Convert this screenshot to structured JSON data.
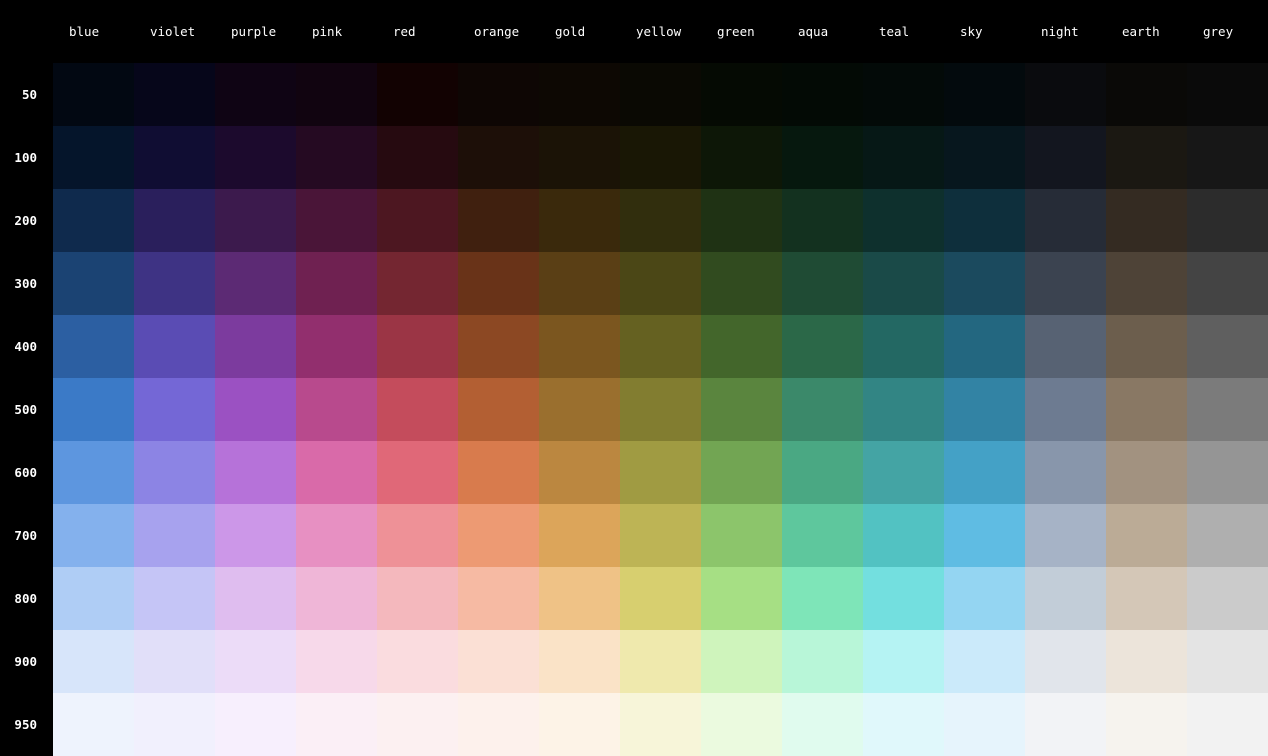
{
  "columns": [
    "blue",
    "violet",
    "purple",
    "pink",
    "red",
    "orange",
    "gold",
    "yellow",
    "green",
    "aqua",
    "teal",
    "sky",
    "night",
    "earth",
    "grey"
  ],
  "rows": [
    "50",
    "100",
    "200",
    "300",
    "400",
    "500",
    "600",
    "700",
    "800",
    "900",
    "950"
  ],
  "colors": {
    "background": "#000000",
    "text": "#ffffff",
    "swatches": [
      [
        "#020812",
        "#06061a",
        "#0f0414",
        "#110410",
        "#120202",
        "#0e0604",
        "#0d0803",
        "#0a0903",
        "#050a03",
        "#030a05",
        "#030a08",
        "#030a0d",
        "#0a0b0e",
        "#0a0907",
        "#0a0a0a"
      ],
      [
        "#05152b",
        "#100d33",
        "#1c0a2d",
        "#250a22",
        "#260a10",
        "#1d0f08",
        "#1b1306",
        "#191705",
        "#0d1707",
        "#06180e",
        "#061816",
        "#07171e",
        "#13161f",
        "#1b1812",
        "#171717"
      ],
      [
        "#0f2a4d",
        "#2a1f5c",
        "#3c1a4d",
        "#4a1538",
        "#4d1721",
        "#40200f",
        "#3a290c",
        "#312e0d",
        "#1f3214",
        "#13311f",
        "#0e302d",
        "#0e2f3c",
        "#262c37",
        "#342b22",
        "#2c2c2c"
      ],
      [
        "#1b4373",
        "#3e3384",
        "#5c2a74",
        "#6f2151",
        "#742631",
        "#693318",
        "#5a3f15",
        "#4b4716",
        "#314b1f",
        "#1f4b34",
        "#1a4a48",
        "#1b4a5e",
        "#3b4350",
        "#4e4337",
        "#444444"
      ],
      [
        "#2c5fa2",
        "#5a4cb4",
        "#7c3b9e",
        "#922f6e",
        "#9b3545",
        "#8c4823",
        "#7b561f",
        "#656121",
        "#43662b",
        "#2b6848",
        "#236863",
        "#236780",
        "#576273",
        "#6c5e4d",
        "#5f5f5f"
      ],
      [
        "#3b7ac7",
        "#7467d6",
        "#9b51c2",
        "#b84a8d",
        "#c44c5c",
        "#b35f33",
        "#9a6f2e",
        "#827d30",
        "#5a853e",
        "#3b896a",
        "#328584",
        "#3283a4",
        "#6d7b91",
        "#897864",
        "#7b7b7b"
      ],
      [
        "#5d96df",
        "#8c84e4",
        "#b672d9",
        "#d96aa9",
        "#e06878",
        "#d87b4d",
        "#bb8740",
        "#a09b42",
        "#72a553",
        "#4aa883",
        "#44a4a4",
        "#44a1c6",
        "#8896ab",
        "#a29280",
        "#959595"
      ],
      [
        "#84b1ed",
        "#a7a2ee",
        "#cc97e8",
        "#e790c2",
        "#ee9197",
        "#ed9a73",
        "#dca55a",
        "#bdb455",
        "#8cc56b",
        "#5ec79d",
        "#52c2c2",
        "#5fbce3",
        "#a6b3c6",
        "#bbab96",
        "#afafaf"
      ],
      [
        "#afcdf5",
        "#c5c5f6",
        "#dfbdef",
        "#efb6d7",
        "#f4b8bd",
        "#f6baa3",
        "#efc286",
        "#d7cf6f",
        "#a6df84",
        "#7ee5b8",
        "#73dfdf",
        "#94d5f2",
        "#c2cdd8",
        "#d4c7b7",
        "#cbcbcb"
      ],
      [
        "#d7e5fa",
        "#e1dff9",
        "#ecdcf8",
        "#f7d9ea",
        "#fadcdf",
        "#fbe0d5",
        "#fae3c7",
        "#efe9ad",
        "#cff4bc",
        "#b8f6d8",
        "#b5f3f3",
        "#cbeafa",
        "#e1e5eb",
        "#ece4da",
        "#e4e4e4"
      ],
      [
        "#eef3fd",
        "#f1f0fd",
        "#f7effd",
        "#fbeff6",
        "#fcf0f1",
        "#fdf1ec",
        "#fdf3e7",
        "#f7f5d9",
        "#ebfadf",
        "#e0fbee",
        "#e0f8fb",
        "#e6f4fc",
        "#f2f3f6",
        "#f6f3ee",
        "#f2f2f2"
      ]
    ]
  }
}
